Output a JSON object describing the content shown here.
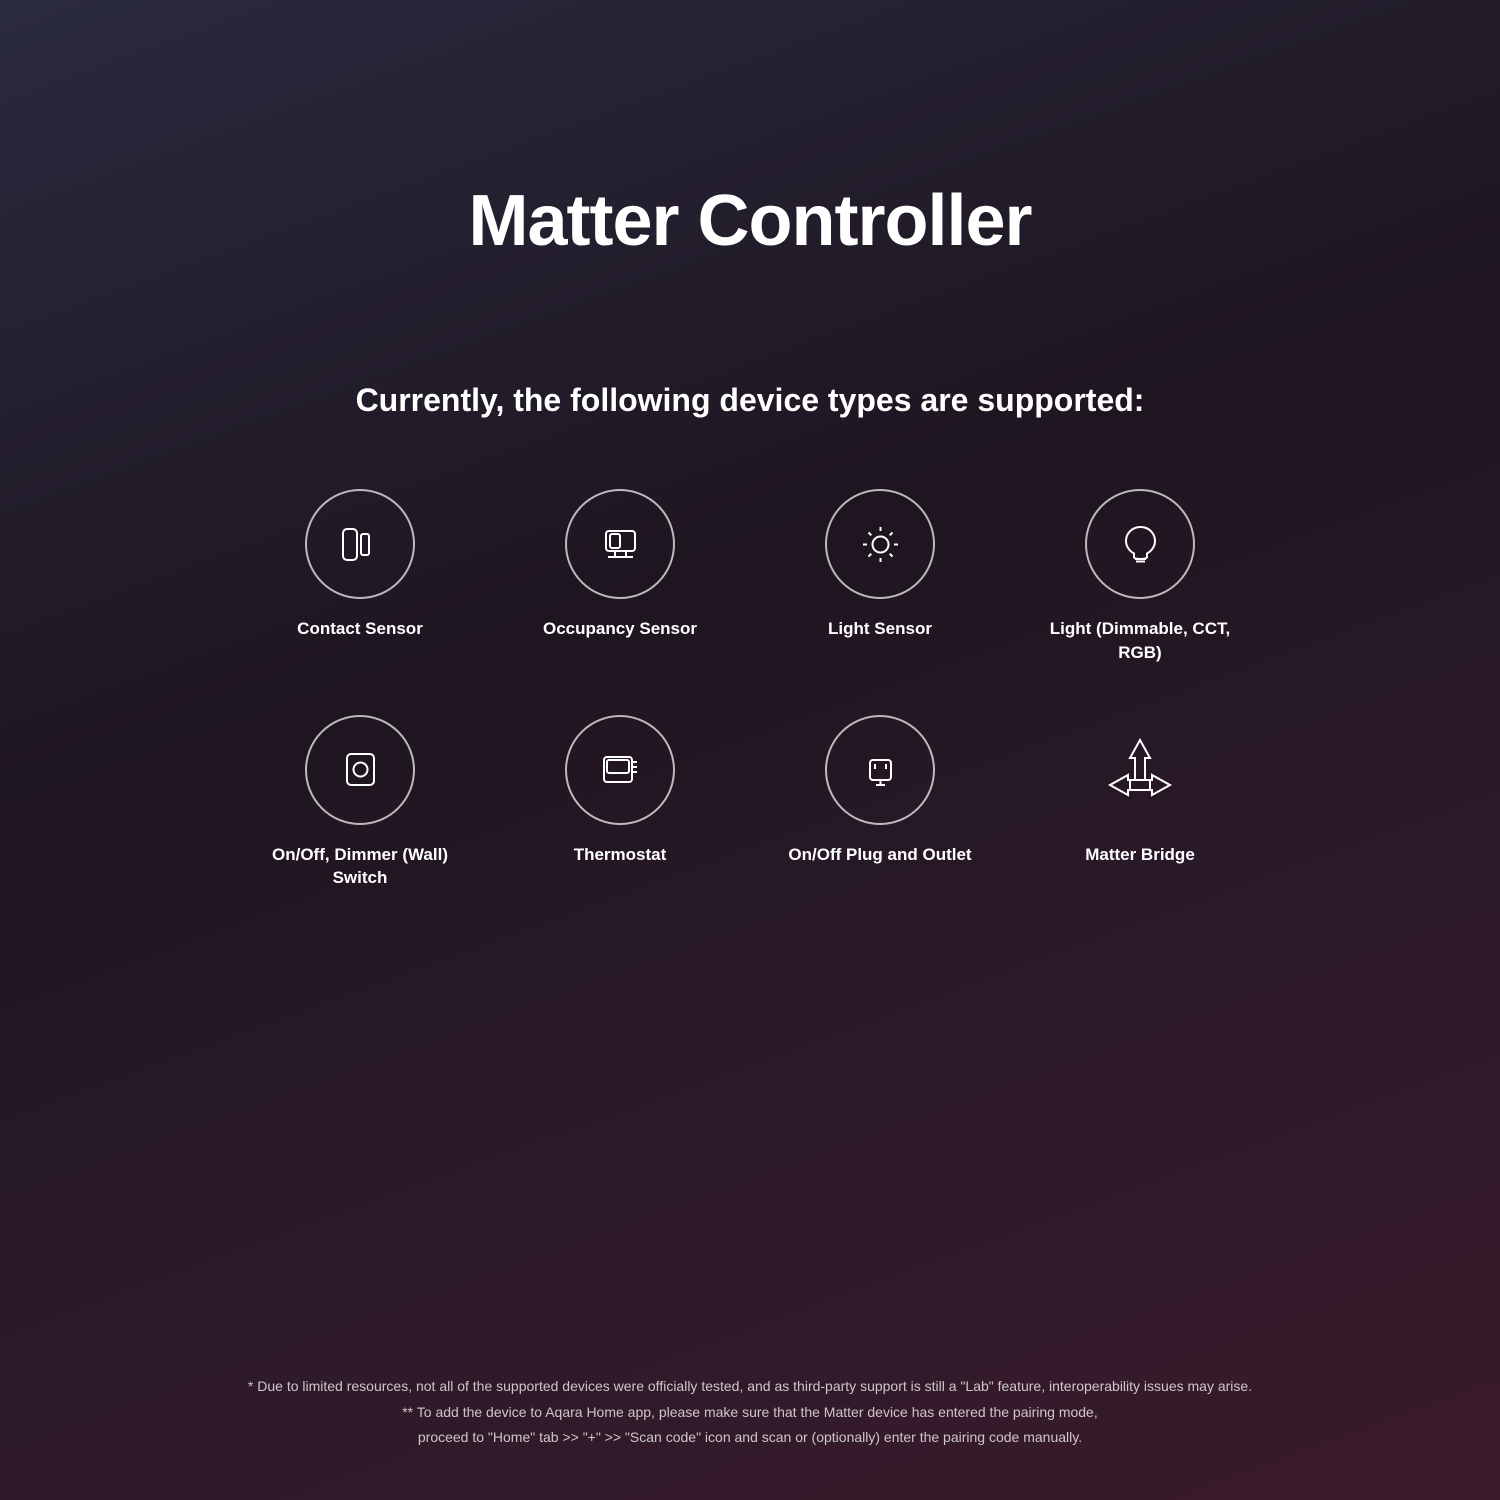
{
  "page": {
    "title": "Matter Controller",
    "subtitle": "Currently, the following device types are supported:",
    "footnote1": "* Due to limited resources, not all of the supported devices were officially tested, and as third-party support is still a \"Lab\" feature, interoperability issues may arise.",
    "footnote2": "** To add the device to Aqara Home app, please make sure that the Matter device has entered the pairing mode,",
    "footnote3": "proceed to \"Home\" tab >> \"+\" >> \"Scan code\" icon and scan or (optionally) enter the pairing code manually."
  },
  "devices": [
    {
      "id": "contact-sensor",
      "label": "Contact Sensor"
    },
    {
      "id": "occupancy-sensor",
      "label": "Occupancy Sensor"
    },
    {
      "id": "light-sensor",
      "label": "Light Sensor"
    },
    {
      "id": "light-dimmable",
      "label": "Light (Dimmable, CCT, RGB)"
    },
    {
      "id": "onoff-dimmer-switch",
      "label": "On/Off, Dimmer (Wall) Switch"
    },
    {
      "id": "thermostat",
      "label": "Thermostat"
    },
    {
      "id": "onoff-plug-outlet",
      "label": "On/Off Plug and Outlet"
    },
    {
      "id": "matter-bridge",
      "label": "Matter Bridge"
    }
  ]
}
